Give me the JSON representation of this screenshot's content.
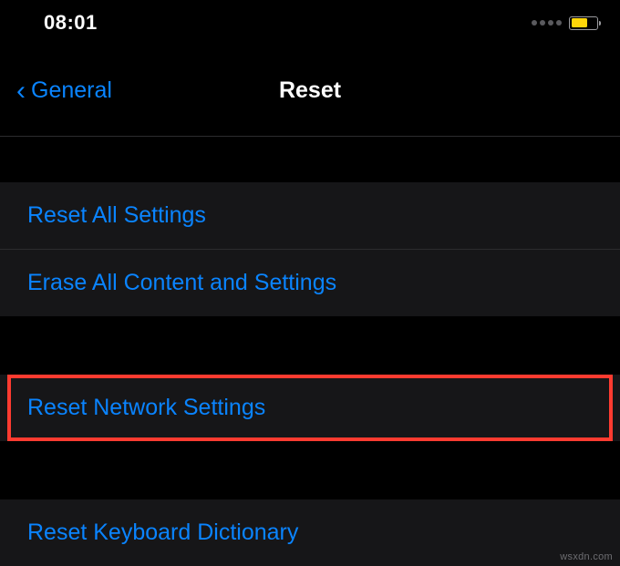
{
  "statusBar": {
    "time": "08:01"
  },
  "nav": {
    "backLabel": "General",
    "title": "Reset"
  },
  "groups": {
    "first": {
      "items": [
        "Reset All Settings",
        "Erase All Content and Settings"
      ]
    },
    "second": {
      "items": [
        "Reset Network Settings"
      ]
    },
    "third": {
      "items": [
        "Reset Keyboard Dictionary"
      ]
    }
  },
  "watermark": "wsxdn.com"
}
